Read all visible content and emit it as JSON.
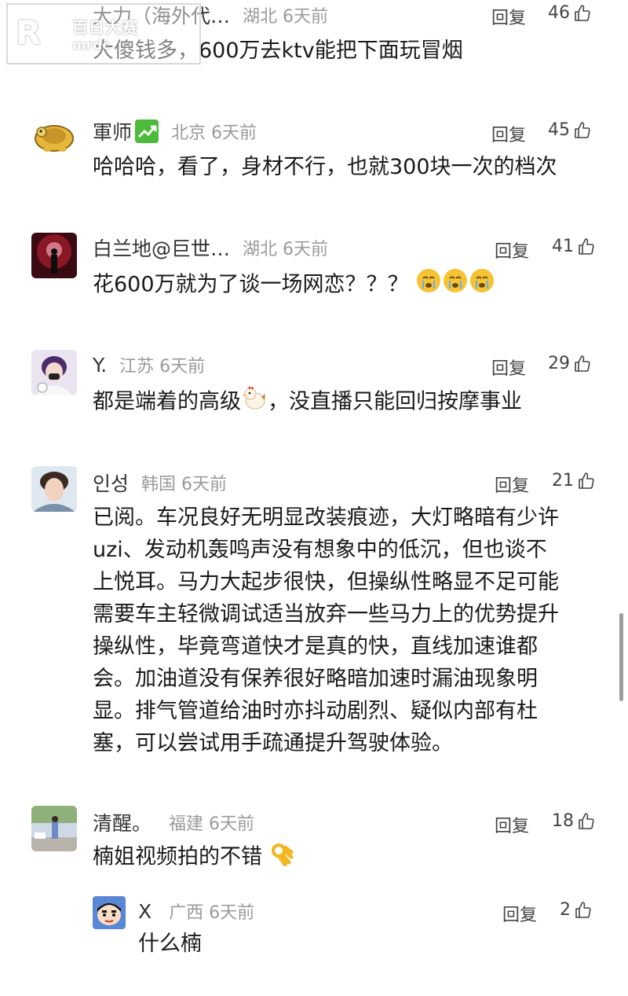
{
  "watermark": {
    "logo_letter": "R",
    "cn": "百日大赛",
    "url": "mrdc"
  },
  "comments": [
    {
      "user": "大力（海外代…",
      "region": "湖北 6天前",
      "reply": "回复",
      "likes": "46",
      "text": "大傻钱多，600万去ktv能把下面玩冒烟"
    },
    {
      "user": "軍师",
      "region": "北京 6天前",
      "reply": "回复",
      "likes": "45",
      "text": "哈哈哈，看了，身材不行，也就300块一次的档次"
    },
    {
      "user": "白兰地@巨世…",
      "region": "湖北 6天前",
      "reply": "回复",
      "likes": "41",
      "text": "花600万就为了谈一场网恋？？？"
    },
    {
      "user": "Y.",
      "region": "江苏 6天前",
      "reply": "回复",
      "likes": "29",
      "text_a": "都是端着的高级",
      "text_b": "，没直播只能回归按摩事业"
    },
    {
      "user": "인성",
      "region": "韩国 6天前",
      "reply": "回复",
      "likes": "21",
      "lines": [
        "已阅。车况良好无明显改装痕迹，大灯略暗有少许",
        "uzi、发动机轰鸣声没有想象中的低沉，但也谈不",
        "上悦耳。马力大起步很快，但操纵性略显不足可能",
        "需要车主轻微调试适当放弃一些马力上的优势提升",
        "操纵性，毕竟弯道快才是真的快，直线加速谁都",
        "会。加油道没有保养很好略暗加速时漏油现象明",
        "显。排气管道给油时亦抖动剧烈、疑似内部有杜",
        "塞，可以尝试用手疏通提升驾驶体验。"
      ]
    },
    {
      "user": "清醒。",
      "region": "福建 6天前",
      "reply": "回复",
      "likes": "18",
      "text": "楠姐视频拍的不错"
    },
    {
      "user": "X",
      "region": "广西 6天前",
      "reply": "回复",
      "likes": "2",
      "text": "什么楠"
    }
  ]
}
